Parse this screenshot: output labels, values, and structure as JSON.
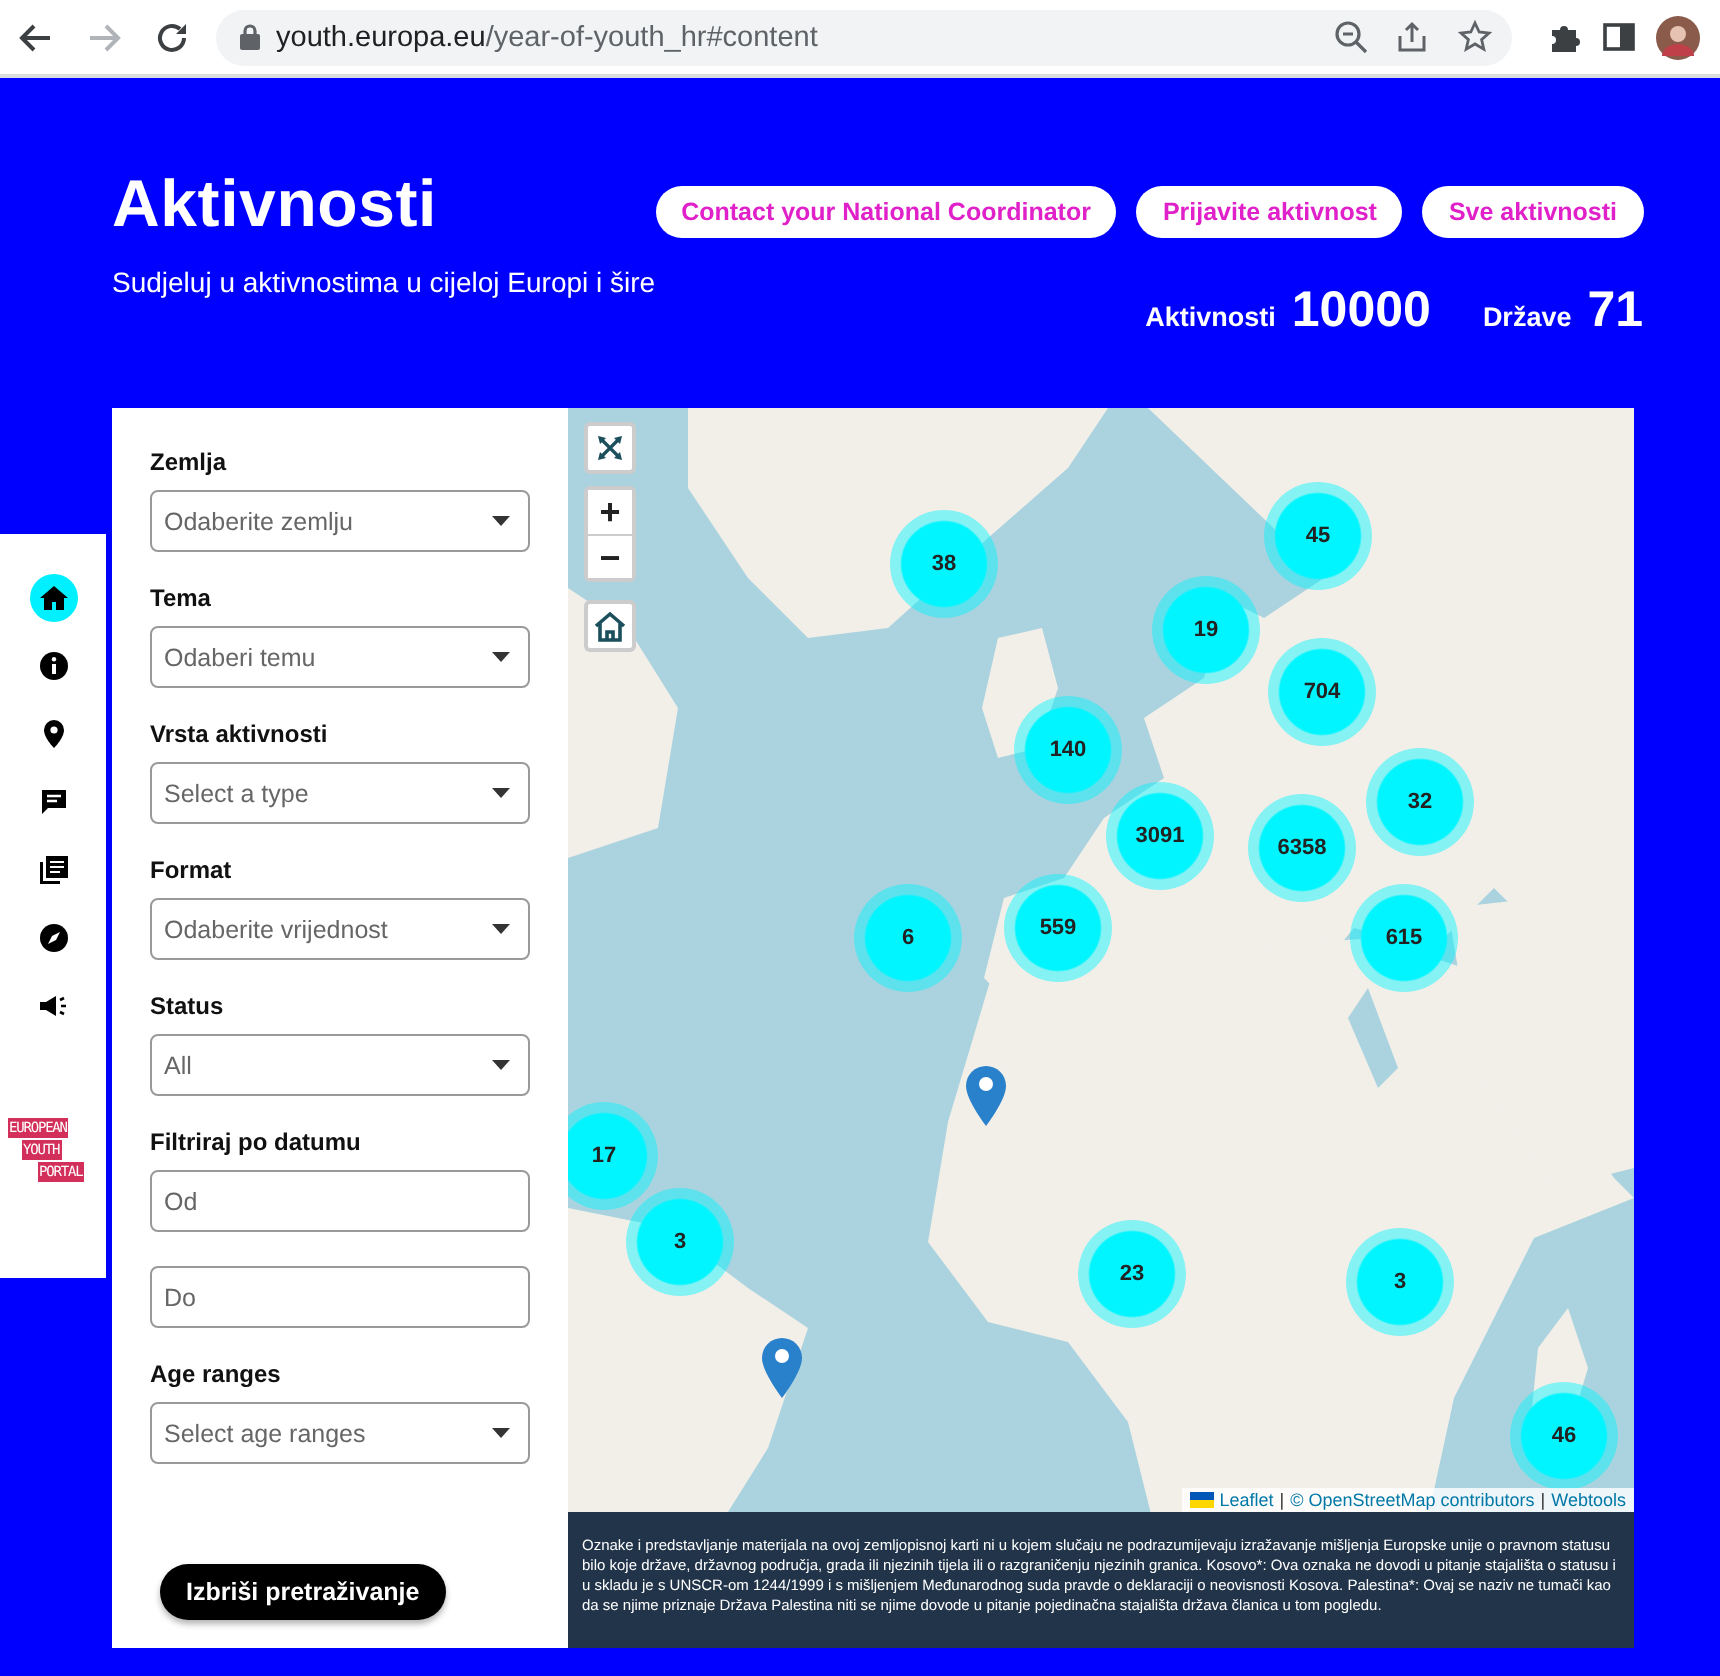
{
  "browser": {
    "nav": [
      {
        "kind": "back",
        "disabled": false
      },
      {
        "kind": "forward",
        "disabled": true
      },
      {
        "kind": "reload",
        "disabled": false
      }
    ],
    "url_host": "youth.europa.eu",
    "url_path": "/year-of-youth_hr#content"
  },
  "header": {
    "title": "Aktivnosti",
    "subtitle": "Sudjeluj u aktivnostima u cijeloj Europi i šire",
    "buttons": [
      "Contact your National Coordinator",
      "Prijavite aktivnost",
      "Sve aktivnosti"
    ],
    "stats": [
      {
        "label": "Aktivnosti",
        "value": "10000"
      },
      {
        "label": "Države",
        "value": "71"
      }
    ]
  },
  "side_nav": {
    "items": [
      {
        "kind": "home",
        "selected": true
      },
      {
        "kind": "info",
        "selected": false
      },
      {
        "kind": "pin",
        "selected": false
      },
      {
        "kind": "chat",
        "selected": false
      },
      {
        "kind": "library",
        "selected": false
      },
      {
        "kind": "compass",
        "selected": false
      },
      {
        "kind": "megaphone",
        "selected": false
      }
    ],
    "logo": [
      "EUROPEAN",
      "YOUTH",
      "PORTAL"
    ]
  },
  "filters": [
    {
      "kind": "select",
      "label": "Zemlja",
      "placeholder": "Odaberite zemlju"
    },
    {
      "kind": "select",
      "label": "Tema",
      "placeholder": "Odaberi temu"
    },
    {
      "kind": "select",
      "label": "Vrsta aktivnosti",
      "placeholder": "Select a type"
    },
    {
      "kind": "select",
      "label": "Format",
      "placeholder": "Odaberite vrijednost"
    },
    {
      "kind": "select",
      "label": "Status",
      "placeholder": "All"
    },
    {
      "kind": "dates",
      "label": "Filtriraj po datumu",
      "fields": [
        {
          "placeholder": "Od"
        },
        {
          "placeholder": "Do"
        }
      ]
    },
    {
      "kind": "select",
      "label": "Age ranges",
      "placeholder": "Select age ranges"
    }
  ],
  "clear_button": "Izbriši pretraživanje",
  "map": {
    "zoom": [
      "+",
      "−"
    ],
    "clusters": [
      {
        "count": "38"
      },
      {
        "count": "45"
      },
      {
        "count": "19"
      },
      {
        "count": "704"
      },
      {
        "count": "140"
      },
      {
        "count": "32"
      },
      {
        "count": "3091"
      },
      {
        "count": "6358"
      },
      {
        "count": "6"
      },
      {
        "count": "559"
      },
      {
        "count": "615"
      },
      {
        "count": "17"
      },
      {
        "count": "3"
      },
      {
        "count": "23"
      },
      {
        "count": "3"
      },
      {
        "count": "46"
      }
    ],
    "attribution": {
      "links": [
        "Leaflet",
        "© OpenStreetMap contributors",
        "Webtools"
      ],
      "separator": "|"
    }
  },
  "disclaimer": "Oznake i predstavljanje materijala na ovoj zemljopisnoj karti ni u kojem slučaju ne podrazumijevaju izražavanje mišljenja Europske unije o pravnom statusu bilo koje države, državnog područja, grada ili njezinih tijela ili o razgraničenju njezinih granica. Kosovo*: Ova oznaka ne dovodi u pitanje stajališta o statusu i u skladu je s UNSCR-om 1244/1999 i s mišljenjem Međunarodnog suda pravde o deklaraciji o neovisnosti Kosova. Palestina*: Ovaj se naziv ne tumači kao da se njime priznaje Država Palestina niti se njime dovode u pitanje pojedinačna stajališta država članica u tom pogledu."
}
